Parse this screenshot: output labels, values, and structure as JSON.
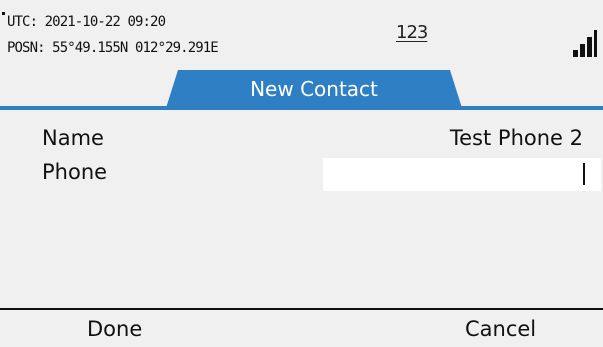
{
  "status": {
    "utc": "UTC:  2021-10-22 09:20",
    "position": "POSN: 55°49.155N 012°29.291E",
    "input_mode": "123",
    "signal_icon": "signal-strength-icon"
  },
  "tab": {
    "title": "New Contact",
    "accent_color": "#2f7fc4"
  },
  "form": {
    "name_label": "Name",
    "name_value": "Test Phone 2",
    "phone_label": "Phone",
    "phone_value": ""
  },
  "softkeys": {
    "left": "Done",
    "right": "Cancel"
  }
}
